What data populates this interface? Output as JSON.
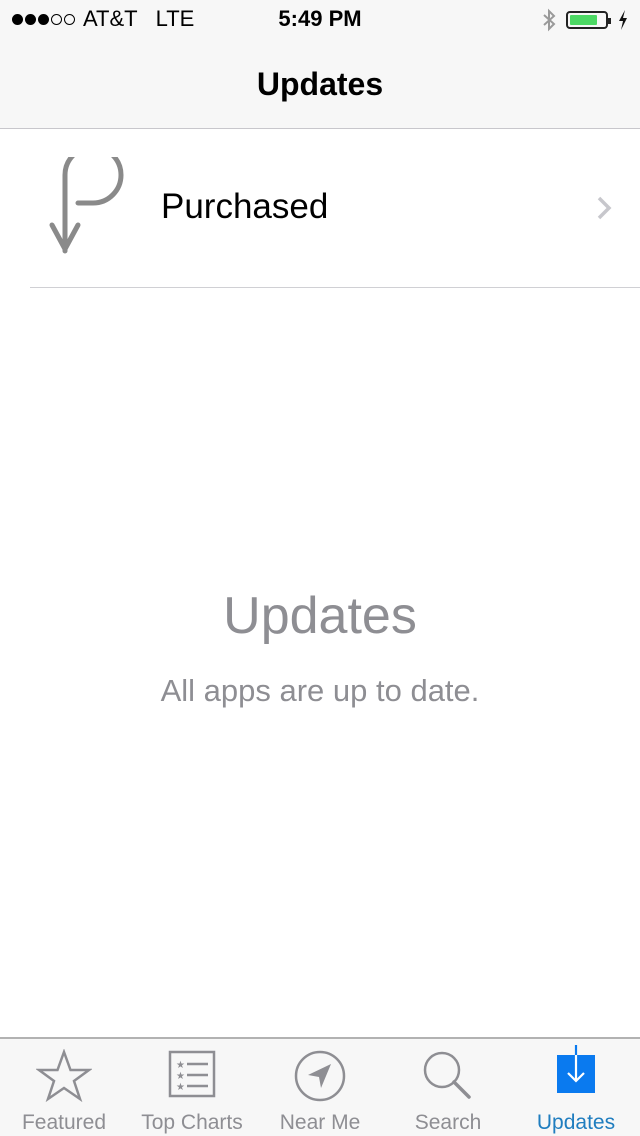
{
  "status_bar": {
    "signal_filled": 3,
    "signal_total": 5,
    "carrier": "AT&T",
    "network": "LTE",
    "time": "5:49 PM",
    "battery_level": 0.8,
    "battery_color": "#4cd964",
    "charging": true
  },
  "nav": {
    "title": "Updates"
  },
  "purchased_row": {
    "label": "Purchased",
    "icon": "purchased-icon"
  },
  "empty_state": {
    "title": "Updates",
    "message": "All apps are up to date."
  },
  "tabbar": {
    "active_color": "#1f7dbf",
    "tabs": [
      {
        "label": "Featured",
        "icon": "star-icon",
        "active": false
      },
      {
        "label": "Top Charts",
        "icon": "list-icon",
        "active": false
      },
      {
        "label": "Near Me",
        "icon": "location-icon",
        "active": false
      },
      {
        "label": "Search",
        "icon": "search-icon",
        "active": false
      },
      {
        "label": "Updates",
        "icon": "updates-icon",
        "active": true
      }
    ]
  }
}
